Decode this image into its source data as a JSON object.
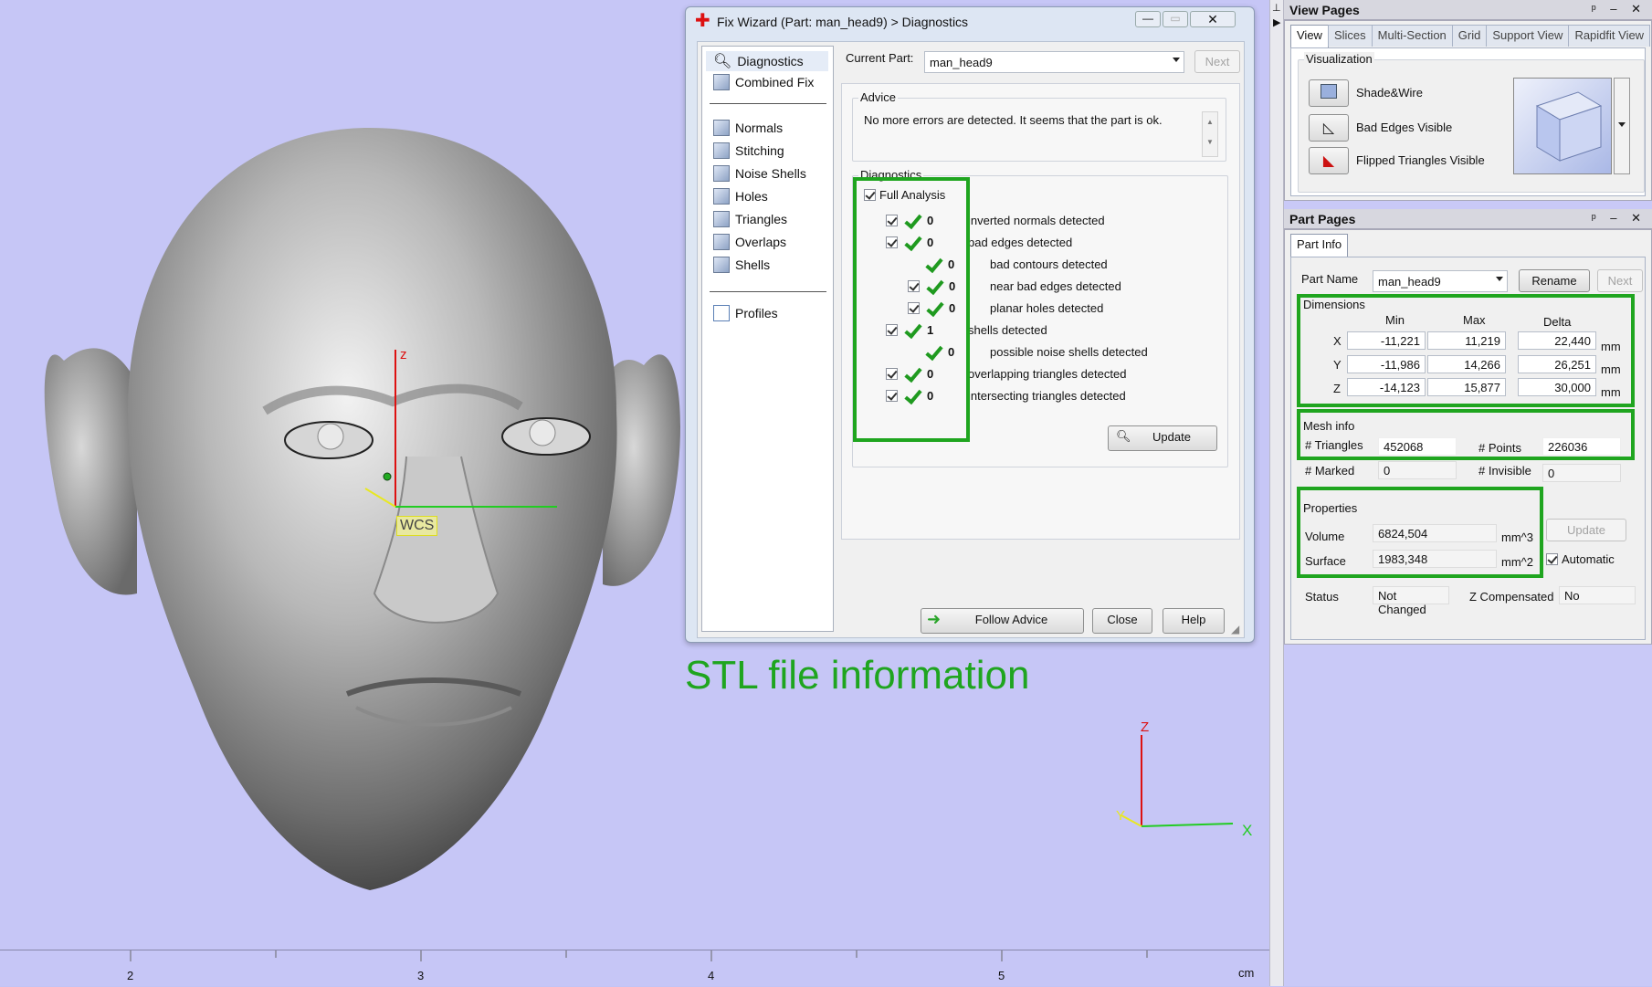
{
  "viewport": {
    "axis_label_z": "z",
    "wcs_label": "WCS",
    "caption": "STL file information",
    "triad": {
      "x": "X",
      "y": "Y",
      "z": "Z"
    },
    "ruler": {
      "ticks": [
        "2",
        "3",
        "4",
        "5"
      ],
      "unit": "cm"
    }
  },
  "fix_wizard": {
    "title": "Fix Wizard (Part: man_head9) > Diagnostics",
    "nav_top": [
      "Diagnostics",
      "Combined Fix"
    ],
    "nav_mid": [
      "Normals",
      "Stitching",
      "Noise Shells",
      "Holes",
      "Triangles",
      "Overlaps",
      "Shells"
    ],
    "nav_bottom": [
      "Profiles"
    ],
    "current_part_label": "Current Part:",
    "current_part_value": "man_head9",
    "next_label": "Next",
    "advice_label": "Advice",
    "advice_text": "No more errors are detected. It seems that the part is ok.",
    "diagnostics_label": "Diagnostics",
    "full_analysis_label": "Full Analysis",
    "rows": [
      {
        "count": "0",
        "text": "inverted normals detected"
      },
      {
        "count": "0",
        "text": "bad edges detected"
      },
      {
        "count": "0",
        "text": "bad contours detected"
      },
      {
        "count": "0",
        "text": "near bad edges detected"
      },
      {
        "count": "0",
        "text": "planar holes detected"
      },
      {
        "count": "1",
        "text": "shells detected"
      },
      {
        "count": "0",
        "text": "possible noise shells detected"
      },
      {
        "count": "0",
        "text": "overlapping triangles detected"
      },
      {
        "count": "0",
        "text": "intersecting triangles detected"
      }
    ],
    "update_label": "Update",
    "follow_advice_label": "Follow Advice",
    "close_label": "Close",
    "help_label": "Help"
  },
  "view_pages": {
    "title": "View Pages",
    "tabs": [
      "View",
      "Slices",
      "Multi-Section",
      "Grid",
      "Support View",
      "Rapidfit View"
    ],
    "visualization_label": "Visualization",
    "options": [
      "Shade&Wire",
      "Bad Edges Visible",
      "Flipped Triangles Visible"
    ]
  },
  "part_pages": {
    "title": "Part Pages",
    "tab": "Part Info",
    "part_name_label": "Part Name",
    "part_name_value": "man_head9",
    "rename_label": "Rename",
    "next_label": "Next",
    "dimensions_label": "Dimensions",
    "dim_headers": [
      "Min",
      "Max",
      "Delta"
    ],
    "dims": [
      {
        "axis": "X",
        "min": "-11,221",
        "max": "11,219",
        "delta": "22,440",
        "unit": "mm"
      },
      {
        "axis": "Y",
        "min": "-11,986",
        "max": "14,266",
        "delta": "26,251",
        "unit": "mm"
      },
      {
        "axis": "Z",
        "min": "-14,123",
        "max": "15,877",
        "delta": "30,000",
        "unit": "mm"
      }
    ],
    "mesh_label": "Mesh info",
    "triangles_label": "# Triangles",
    "triangles_value": "452068",
    "points_label": "# Points",
    "points_value": "226036",
    "marked_label": "# Marked",
    "marked_value": "0",
    "invisible_label": "# Invisible",
    "invisible_value": "0",
    "properties_label": "Properties",
    "volume_label": "Volume",
    "volume_value": "6824,504",
    "volume_unit": "mm^3",
    "surface_label": "Surface",
    "surface_value": "1983,348",
    "surface_unit": "mm^2",
    "update_label": "Update",
    "automatic_label": "Automatic",
    "status_label": "Status",
    "status_value": "Not Changed",
    "zcomp_label": "Z Compensated",
    "zcomp_value": "No"
  },
  "colors": {
    "highlight": "#1fa51f",
    "viewport_bg": "#c6c6f6",
    "caption": "#1fa51f"
  }
}
